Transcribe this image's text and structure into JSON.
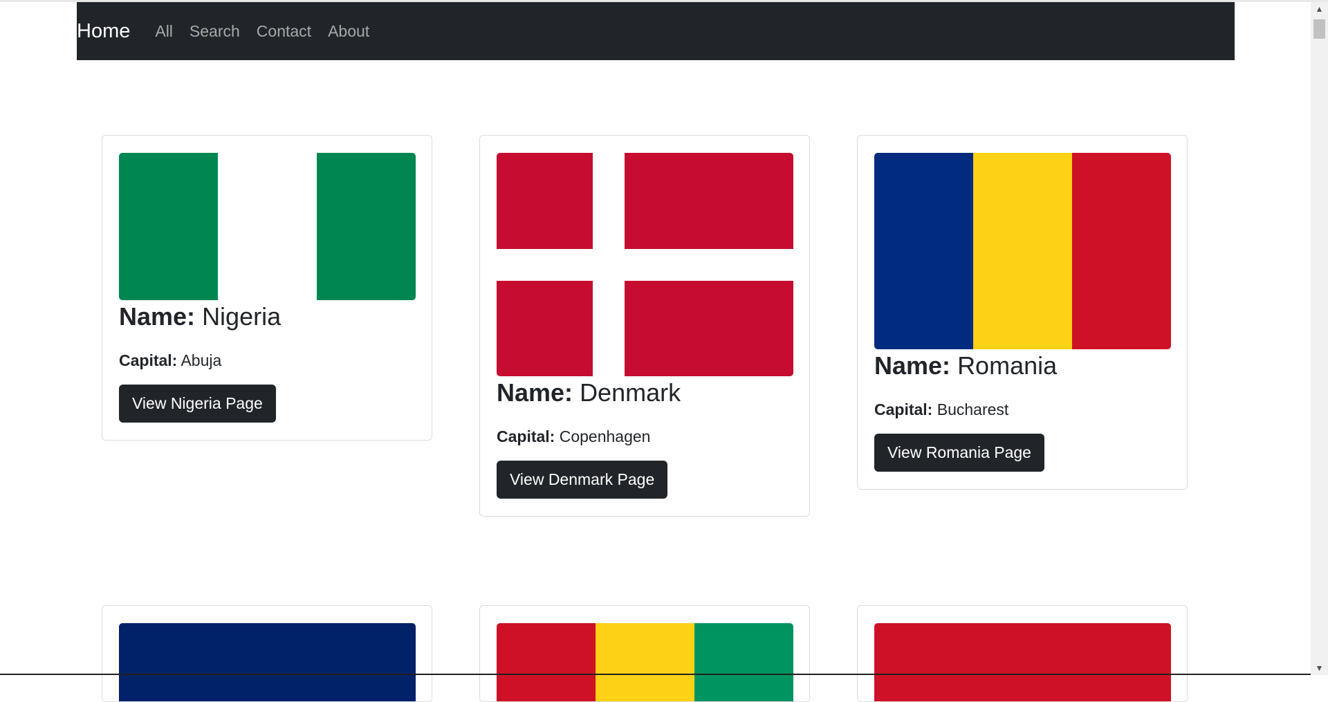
{
  "navbar": {
    "brand": "Home",
    "links": [
      "All",
      "Search",
      "Contact",
      "About"
    ]
  },
  "label_name": "Name:",
  "label_capital": "Capital:",
  "cards": [
    {
      "name": "Nigeria",
      "capital": "Abuja",
      "button": "View Nigeria Page",
      "flag_colors": [
        "#008751",
        "#ffffff",
        "#008751"
      ]
    },
    {
      "name": "Denmark",
      "capital": "Copenhagen",
      "button": "View Denmark Page",
      "flag_colors": [
        "#c60c30",
        "#ffffff"
      ]
    },
    {
      "name": "Romania",
      "capital": "Bucharest",
      "button": "View Romania Page",
      "flag_colors": [
        "#002b7f",
        "#fcd116",
        "#ce1126"
      ]
    }
  ],
  "partial_cards": [
    {
      "flag_colors": [
        "#012169"
      ]
    },
    {
      "flag_colors": [
        "#ce1126",
        "#fcd116",
        "#009460"
      ]
    },
    {
      "flag_colors": [
        "#ce1126"
      ]
    }
  ]
}
